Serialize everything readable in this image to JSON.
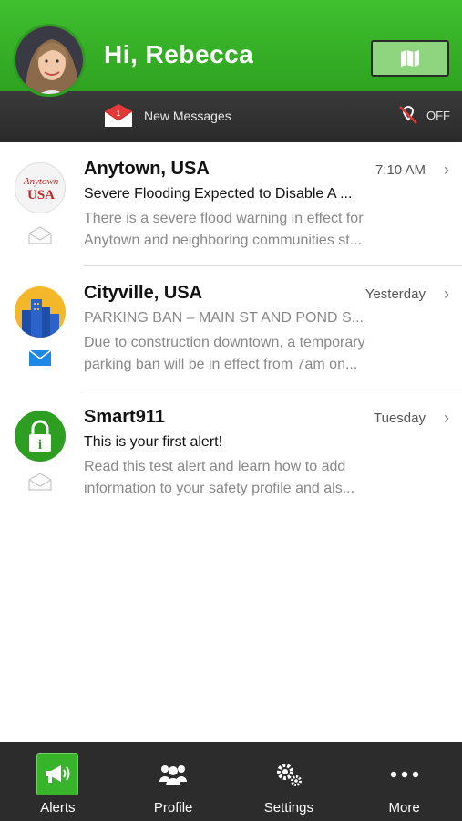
{
  "header": {
    "greeting": "Hi, Rebecca",
    "view_toggle": {
      "map_icon": "map-icon",
      "list_icon": "list-icon",
      "selected": "list"
    }
  },
  "subbar": {
    "new_messages_label": "New Messages",
    "new_messages_count": "1",
    "location_status": "OFF"
  },
  "alerts": [
    {
      "title": "Anytown, USA",
      "time": "7:10 AM",
      "subject": "Severe Flooding Expected to Disable A ...",
      "preview_line1": "There is a severe flood warning in effect for",
      "preview_line2": "Anytown and neighboring communities st...",
      "logo_text_top": "Anytown",
      "logo_text_bottom": "USA",
      "status": "read"
    },
    {
      "title": "Cityville, USA",
      "time": "Yesterday",
      "subject": "PARKING BAN – MAIN ST AND POND S...",
      "preview_line1": "Due to construction downtown, a temporary",
      "preview_line2": "parking ban will be in effect from 7am on...",
      "status": "unread"
    },
    {
      "title": "Smart911",
      "time": "Tuesday",
      "subject": "This is your first alert!",
      "preview_line1": "Read this test alert and learn how to add",
      "preview_line2": "information to your safety profile and als...",
      "status": "read"
    }
  ],
  "tabs": [
    {
      "label": "Alerts",
      "icon": "megaphone-icon",
      "active": true
    },
    {
      "label": "Profile",
      "icon": "people-icon",
      "active": false
    },
    {
      "label": "Settings",
      "icon": "gears-icon",
      "active": false
    },
    {
      "label": "More",
      "icon": "more-dots-icon",
      "active": false
    }
  ],
  "colors": {
    "brand_green": "#37b42a",
    "dark_bar": "#2c2c2c",
    "unread_blue": "#1e88e5",
    "alert_red": "#e53935"
  }
}
